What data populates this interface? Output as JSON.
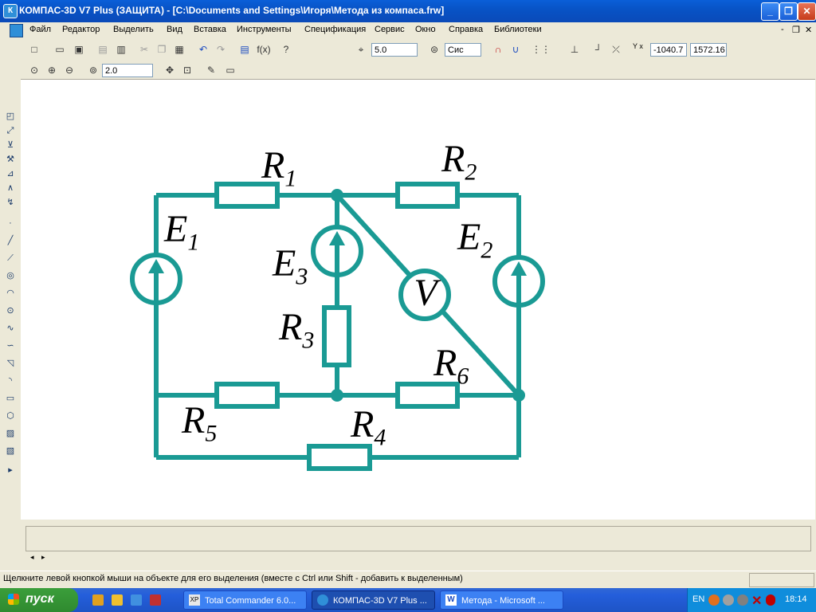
{
  "window": {
    "title": "КОМПАС-3D V7 Plus (ЗАЩИТА) - [C:\\Documents and Settings\\Игоря\\Метода из компаса.frw]"
  },
  "menu": [
    "Файл",
    "Редактор",
    "Выделить",
    "Вид",
    "Вставка",
    "Инструменты",
    "Спецификация",
    "Сервис",
    "Окно",
    "Справка",
    "Библиотеки"
  ],
  "toolbar": {
    "step_value": "5.0",
    "style_value": "Сис",
    "coord_x": "-1040.7",
    "coord_y": "1572.16",
    "coord_label": "Y x",
    "zoom_value": "2.0",
    "fx_label": "f(x)"
  },
  "circuit": {
    "R1": "R",
    "R1s": "1",
    "R2": "R",
    "R2s": "2",
    "R3": "R",
    "R3s": "3",
    "R4": "R",
    "R4s": "4",
    "R5": "R",
    "R5s": "5",
    "R6": "R",
    "R6s": "6",
    "E1": "E",
    "E1s": "1",
    "E2": "E",
    "E2s": "2",
    "E3": "E",
    "E3s": "3",
    "V": "V",
    "wire_color": "#1a9a94"
  },
  "status": {
    "hint": "Щелкните левой кнопкой мыши на объекте для его выделения (вместе с Ctrl или Shift - добавить к выделенным)"
  },
  "taskbar": {
    "start": "пуск",
    "tasks": [
      "Total Commander 6.0...",
      "КОМПАС-3D V7 Plus ...",
      "Метода - Microsoft ..."
    ],
    "lang": "EN",
    "time": "18:14"
  }
}
